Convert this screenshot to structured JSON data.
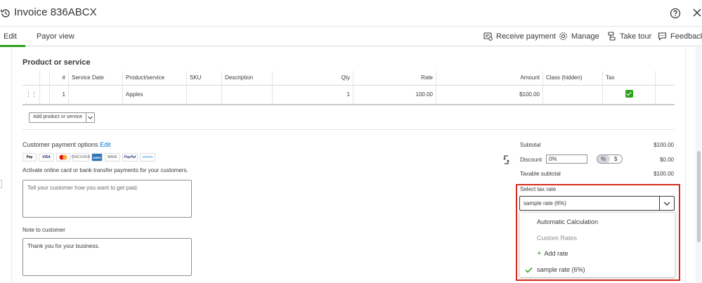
{
  "header": {
    "title": "Invoice 836ABCX",
    "tabs": [
      {
        "label": "Edit",
        "active": true
      },
      {
        "label": "Payor view",
        "active": false
      }
    ],
    "tools": {
      "receive_payment": "Receive payment",
      "manage": "Manage",
      "take_tour": "Take tour",
      "feedback": "Feedback"
    }
  },
  "products": {
    "section_title": "Product or service",
    "columns": [
      "#",
      "Service Date",
      "Product/service",
      "SKU",
      "Description",
      "Qty",
      "Rate",
      "Amount",
      "Class (hidden)",
      "Tax"
    ],
    "rows": [
      {
        "num": "1",
        "service_date": "",
        "product": "Apples",
        "sku": "",
        "description": "",
        "qty": "1",
        "rate": "100.00",
        "amount": "$100.00",
        "class": "",
        "tax_checked": true
      }
    ],
    "add_button": "Add product or service"
  },
  "payment_options": {
    "title": "Customer payment options",
    "edit_link": "Edit",
    "cards": [
      "Pay",
      "VISA",
      "",
      "DISCOVER",
      "AMEX",
      "BANK",
      "PayPal",
      "venmo"
    ],
    "activate_text": "Activate online card or bank transfer payments for your customers.",
    "how_to_pay_placeholder": "Tell your customer how you want to get paid."
  },
  "note": {
    "label": "Note to customer",
    "value": "Thank you for your business."
  },
  "totals": {
    "subtotal_label": "Subtotal",
    "subtotal_value": "$100.00",
    "discount_label": "Discount",
    "discount_input": "0%",
    "percent_symbol": "%",
    "dollar_symbol": "$",
    "discount_value": "$0.00",
    "taxable_label": "Taxable subtotal",
    "taxable_value": "$100.00"
  },
  "tax_rate": {
    "label": "Select tax rate",
    "selected": "sample rate (6%)",
    "options": {
      "automatic": "Automatic Calculation",
      "custom_header": "Custom Rates",
      "add_rate": "Add rate",
      "sample": "sample rate (6%)"
    }
  },
  "colors": {
    "accent_green": "#2ca01c",
    "link_blue": "#0077c5",
    "highlight_red": "#d52b1e"
  }
}
